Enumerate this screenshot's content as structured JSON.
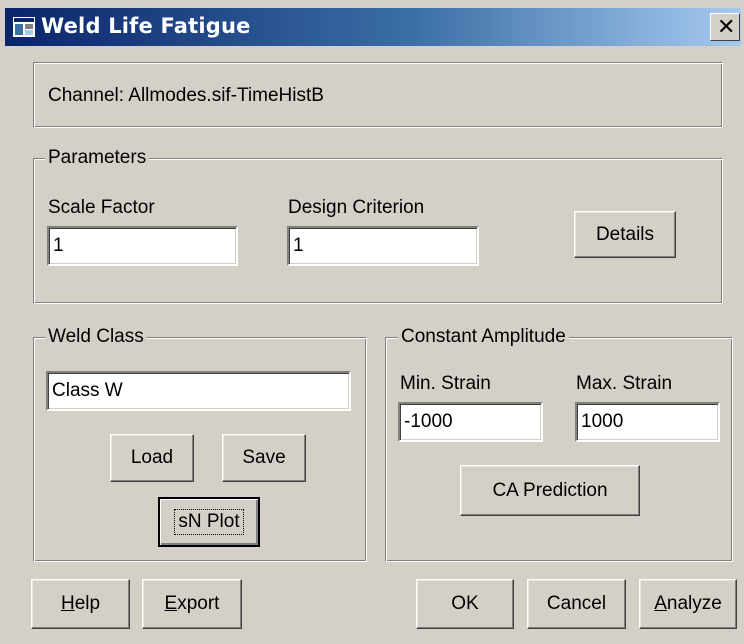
{
  "window": {
    "title": "Weld Life Fatigue",
    "icon": "app-icon",
    "close_glyph": "✕"
  },
  "channel": {
    "text": "Channel: Allmodes.sif-TimeHistB"
  },
  "parameters": {
    "legend": "Parameters",
    "scale_factor_label": "Scale Factor",
    "scale_factor_value": "1",
    "design_criterion_label": "Design Criterion",
    "design_criterion_value": "1",
    "details_label": "Details"
  },
  "weld_class": {
    "legend": "Weld Class",
    "class_value": "Class W",
    "load_label": "Load",
    "save_label": "Save",
    "sn_plot_label": "sN Plot"
  },
  "constant_amplitude": {
    "legend": "Constant Amplitude",
    "min_strain_label": "Min. Strain",
    "min_strain_value": "-1000",
    "max_strain_label": "Max. Strain",
    "max_strain_value": "1000",
    "ca_prediction_label": "CA Prediction"
  },
  "footer": {
    "help_mnemonic": "H",
    "help_rest": "elp",
    "export_mnemonic": "E",
    "export_rest": "xport",
    "ok_label": "OK",
    "cancel_label": "Cancel",
    "analyze_mnemonic": "A",
    "analyze_rest": "nalyze"
  }
}
